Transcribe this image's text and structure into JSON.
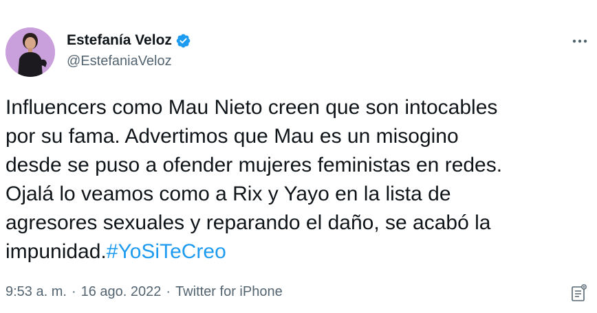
{
  "author": {
    "display_name": "Estefanía Veloz",
    "handle": "@EstefaniaVeloz",
    "verified": true,
    "avatar_icon": "profile-photo"
  },
  "tweet": {
    "lines": [
      "Influencers como Mau Nieto creen que son intocables",
      "por su fama. Advertimos que Mau es un misogino",
      "desde se puso a ofender mujeres feministas en redes.",
      "Ojalá lo veamos como a Rix y Yayo en la lista de",
      "agresores sexuales y reparando el daño, se acabó la",
      "impunidad."
    ],
    "hashtag": "#YoSiTeCreo"
  },
  "meta": {
    "time": "9:53 a. m.",
    "separator": "·",
    "date": "16 ago. 2022",
    "source": "Twitter for iPhone"
  },
  "icons": {
    "more": "more-horizontal-icon",
    "verified": "verified-badge-icon",
    "notes": "notes-icon"
  },
  "colors": {
    "text": "#0f1419",
    "secondary": "#536471",
    "accent": "#1d9bf0",
    "avatar_bg": "#c9a0dc"
  }
}
